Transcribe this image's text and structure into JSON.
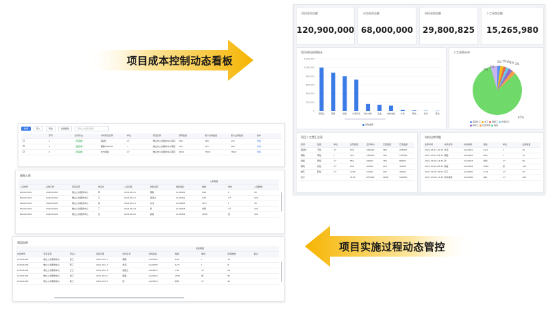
{
  "banner_top": {
    "text": "项目成本控制动态看板"
  },
  "banner_bottom": {
    "text": "项目实施过程动态管控"
  },
  "kpis": [
    {
      "label": "项目合同总额",
      "value": "120,900,000"
    },
    {
      "label": "分包合同总额",
      "value": "68,000,000"
    },
    {
      "label": "材料采购总额",
      "value": "29,800,825"
    },
    {
      "label": "人工采购总额",
      "value": "15,265,980"
    }
  ],
  "bar_chart": {
    "title": "项目材料采购统计",
    "legend": "采购金额",
    "chart_data": {
      "type": "bar",
      "categories": [
        "混凝土",
        "钢筋",
        "模板",
        "水泥砂浆",
        "防水材料",
        "五金",
        "电线电缆",
        "水管",
        "砌块",
        "管材",
        "其他"
      ],
      "values": [
        1000000,
        880000,
        800000,
        720000,
        160000,
        140000,
        120000,
        20000,
        10000,
        5000,
        3000
      ],
      "ylim": [
        0,
        1200000
      ],
      "yticks": [
        "0",
        "200,000",
        "400,000",
        "600,000",
        "800,000",
        "1,000,000",
        "1,200,000"
      ]
    }
  },
  "pie_chart": {
    "title": "人工采购分布",
    "main_label": "87%",
    "small_labels": [
      "2%",
      "1%",
      "1%",
      "1%",
      "2%",
      "2%",
      "5%"
    ],
    "legend": [
      {
        "name": "混凝土工",
        "color": "#5b8ff9"
      },
      {
        "name": "木工",
        "color": "#f6bd16"
      },
      {
        "name": "钢筋工",
        "color": "#e8684a"
      },
      {
        "name": "普通杂工",
        "color": "#6dc8ec"
      },
      {
        "name": "抹灰工",
        "color": "#9270ca"
      },
      {
        "name": "管道安装",
        "color": "#ff9d4d"
      },
      {
        "name": "其他",
        "color": "#5ad8a6"
      }
    ]
  },
  "bl_card": {
    "title": "项目人工费汇总表"
  },
  "br_card": {
    "title": "材料出库明细"
  },
  "bl_table": {
    "headers": [
      "名称",
      "班组",
      "单位",
      "合同数量",
      "合同单价",
      "已完数量",
      "已完金额"
    ],
    "rows": [
      [
        "混凝土",
        "王班",
        "m³",
        "500",
        "280000",
        "480",
        "268000"
      ],
      [
        "钢筋",
        "李班",
        "t",
        "320",
        "180000",
        "300",
        "165000"
      ],
      [
        "模板",
        "张班",
        "m²",
        "850",
        "96000",
        "780",
        "88000"
      ],
      [
        "砌筑",
        "刘班",
        "m³",
        "260",
        "45000",
        "220",
        "39000"
      ],
      [
        "抹灰",
        "陈班",
        "m²",
        "1200",
        "52000",
        "900",
        "39000"
      ],
      [
        "合计",
        "",
        "",
        "3130",
        "653000",
        "2680",
        "599000"
      ]
    ]
  },
  "br_table": {
    "headers": [
      "出库时间",
      "材料名称",
      "材料编码",
      "规格",
      "单位",
      "出库数量"
    ],
    "rows": [
      [
        "2021-03-12 10:20",
        "水泥",
        "CL20001",
        "42.5",
        "t",
        "20"
      ],
      [
        "2021-03-15 09:12",
        "钢筋",
        "CL20002",
        "Φ12",
        "t",
        "15"
      ],
      [
        "2021-03-18 14:30",
        "砂",
        "CL20003",
        "中砂",
        "m³",
        "60"
      ],
      [
        "2021-03-22 08:45",
        "模板",
        "CL20004",
        "1830",
        "张",
        "120"
      ],
      [
        "2021-03-25 16:05",
        "石子",
        "CL20005",
        "5-25",
        "m³",
        "45"
      ],
      [
        "2021-03-28 11:40",
        "防水卷材",
        "CL20006",
        "SBS",
        "m²",
        "300"
      ]
    ]
  },
  "top_table": {
    "toolbar": [
      "新增",
      "导入",
      "导出",
      "批量删除",
      "请输入关键词搜索"
    ],
    "headers": [
      "",
      "序号",
      "合同状态",
      "材料项目名称",
      "单位",
      "项目名称",
      "预算数量",
      "累计采购数量",
      "累计出库数量",
      "操作"
    ],
    "rows": [
      [
        "",
        "1",
        "已完成",
        "混凝土",
        "m³",
        "佛山市公共服务中心项目",
        "500",
        "480",
        "470",
        "详情"
      ],
      [
        "",
        "2",
        "进行中",
        "钢筋HRB400",
        "t",
        "佛山市公共服务中心项目",
        "320",
        "300",
        "280",
        "详情"
      ],
      [
        "",
        "3",
        "已完成",
        "木方模板",
        "m²",
        "佛山市公共服务中心项目",
        "8000",
        "7800",
        "7600",
        "详情"
      ]
    ]
  },
  "inbound_table": {
    "title": "采购入库",
    "group_header": "入库明细",
    "headers": [
      "入库单号",
      "采购订单",
      "项目名称",
      "供应商",
      "入库日期",
      "材料名称",
      "材料编码",
      "规格",
      "单位",
      "入库数量"
    ],
    "rows": [
      [
        "RK2021001",
        "CG2021001",
        "佛山公共服务中心",
        "甲",
        "2021-03-10",
        "钢筋",
        "CL20002",
        "Φ16",
        "t",
        "50"
      ],
      [
        "RK2021002",
        "CG2021002",
        "佛山公共服务中心",
        "乙",
        "2021-03-12",
        "混凝土",
        "CL20001",
        "C30",
        "m³",
        "200"
      ],
      [
        "RK2021003",
        "CG2021003",
        "佛山公共服务中心",
        "丙",
        "2021-03-15",
        "水泥",
        "CL20005",
        "42.5",
        "t",
        "30"
      ],
      [
        "RK2021004",
        "CG2021004",
        "佛山公共服务中心",
        "丁",
        "2021-03-18",
        "砂",
        "CL20003",
        "中砂",
        "m³",
        "100"
      ],
      [
        "RK2021005",
        "CG2021005",
        "佛山公共服务中心",
        "戊",
        "2021-03-20",
        "模板",
        "CL20004",
        "1830",
        "张",
        "300"
      ]
    ]
  },
  "outbound_table": {
    "title": "领用出库",
    "group_header": "领用明细",
    "headers": [
      "出库单号",
      "项目名称",
      "申请人",
      "领用日期",
      "材料名称",
      "材料编码",
      "规格",
      "单位",
      "出库数量",
      "备注"
    ],
    "rows": [
      [
        "LY2021001",
        "佛山公共服务中心",
        "张工",
        "2021-03-12",
        "钢筋",
        "CL20002",
        "Φ12",
        "t",
        "10",
        ""
      ],
      [
        "LY2021002",
        "佛山公共服务中心",
        "李工",
        "2021-03-15",
        "水泥",
        "CL20005",
        "42.5",
        "t",
        "8",
        ""
      ],
      [
        "LY2021003",
        "佛山公共服务中心",
        "王工",
        "2021-03-18",
        "混凝土",
        "CL20001",
        "C30",
        "m³",
        "60",
        ""
      ],
      [
        "LY2021004",
        "佛山公共服务中心",
        "刘工",
        "2021-03-21",
        "模板",
        "CL20004",
        "1830",
        "张",
        "80",
        ""
      ],
      [
        "LY2021005",
        "佛山公共服务中心",
        "陈工",
        "2021-03-25",
        "砂",
        "CL20003",
        "中砂",
        "m³",
        "40",
        ""
      ]
    ]
  },
  "colors": {
    "accent": "#3b7be6",
    "arrow": "#f5b800",
    "pie_main": "#6fd96a"
  }
}
